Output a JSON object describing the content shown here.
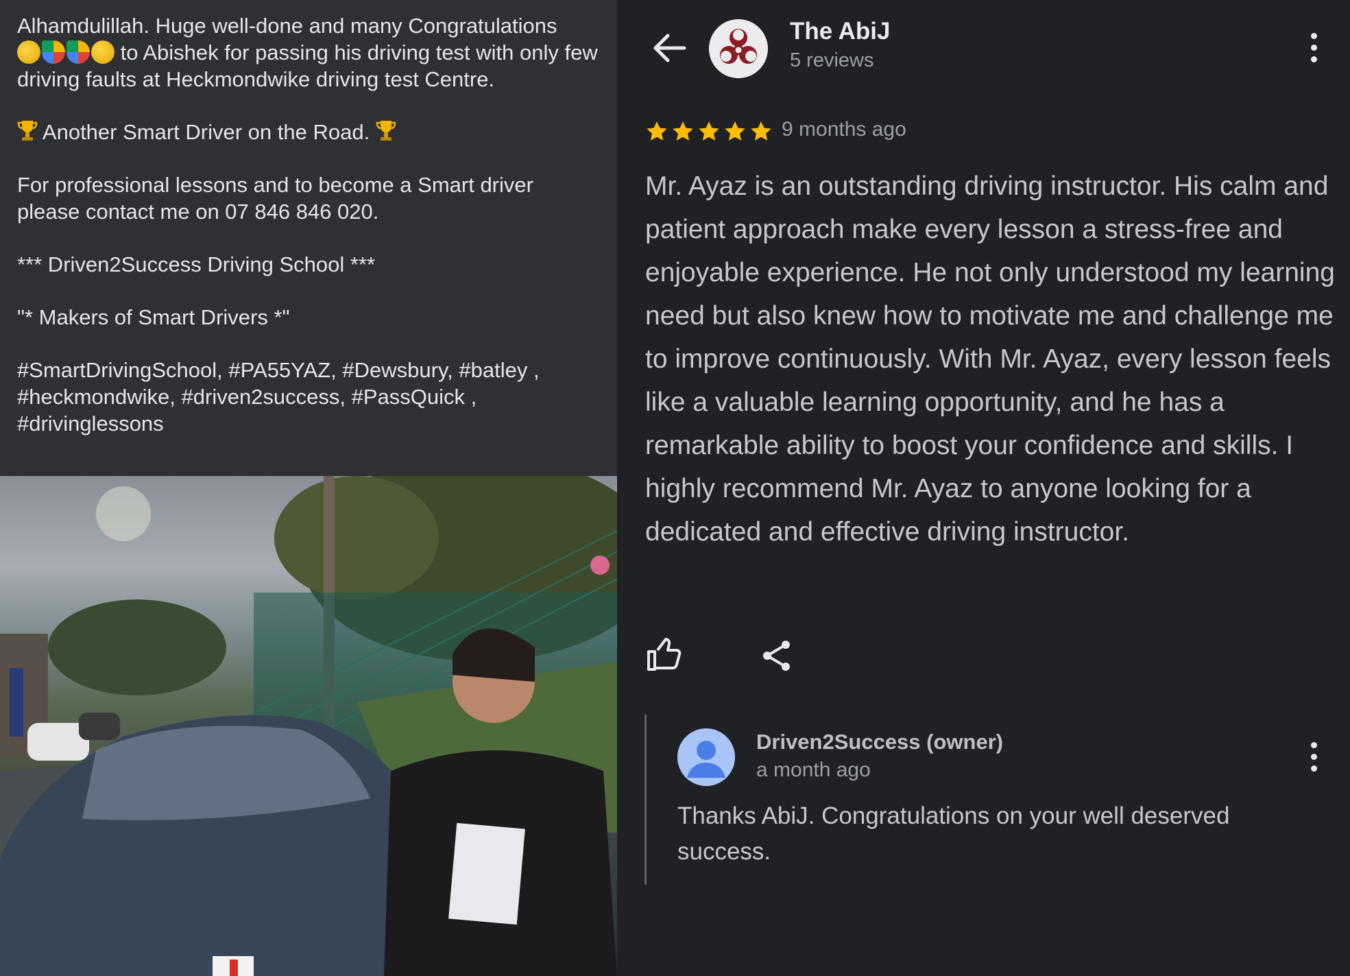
{
  "post": {
    "paragraph1_a": "Alhamdulillah. Huge well-done and many Congratulations",
    "paragraph1_b": "to Abishek for passing his driving test with only few driving faults at Heckmondwike driving test Centre.",
    "paragraph1_emojis": [
      "clapping-hands",
      "party-popper",
      "party-popper",
      "clapping-hands"
    ],
    "paragraph2": "Another Smart Driver on the Road.",
    "paragraph3": "For professional lessons and to become a Smart driver please contact me on 07 846 846 020.",
    "paragraph4": "*** Driven2Success Driving School ***",
    "paragraph5": "\"* Makers of Smart Drivers *\"",
    "paragraph6": "#SmartDrivingSchool, #PA55YAZ, #Dewsbury, #batley , #heckmondwike, #driven2success, #PassQuick , #drivinglessons"
  },
  "review": {
    "reviewer_name": "The AbiJ",
    "reviewer_meta": "5 reviews",
    "rating": 5,
    "time": "9 months ago",
    "body": "Mr. Ayaz is an outstanding driving instructor. His calm and patient approach make every lesson a stress-free and enjoyable experience. He not only understood my learning need but also knew how to motivate me and challenge me to improve continuously. With Mr. Ayaz, every lesson feels like a valuable learning opportunity, and he has a remarkable ability to boost your confidence and skills. I highly recommend Mr. Ayaz to anyone looking for a dedicated and effective driving instructor."
  },
  "owner_reply": {
    "name": "Driven2Success (owner)",
    "time": "a month ago",
    "text": "Thanks AbiJ. Congratulations on your well deserved success."
  },
  "colors": {
    "star": "#fbbc04",
    "page_bg": "#202124",
    "post_bg": "#2f3033"
  }
}
